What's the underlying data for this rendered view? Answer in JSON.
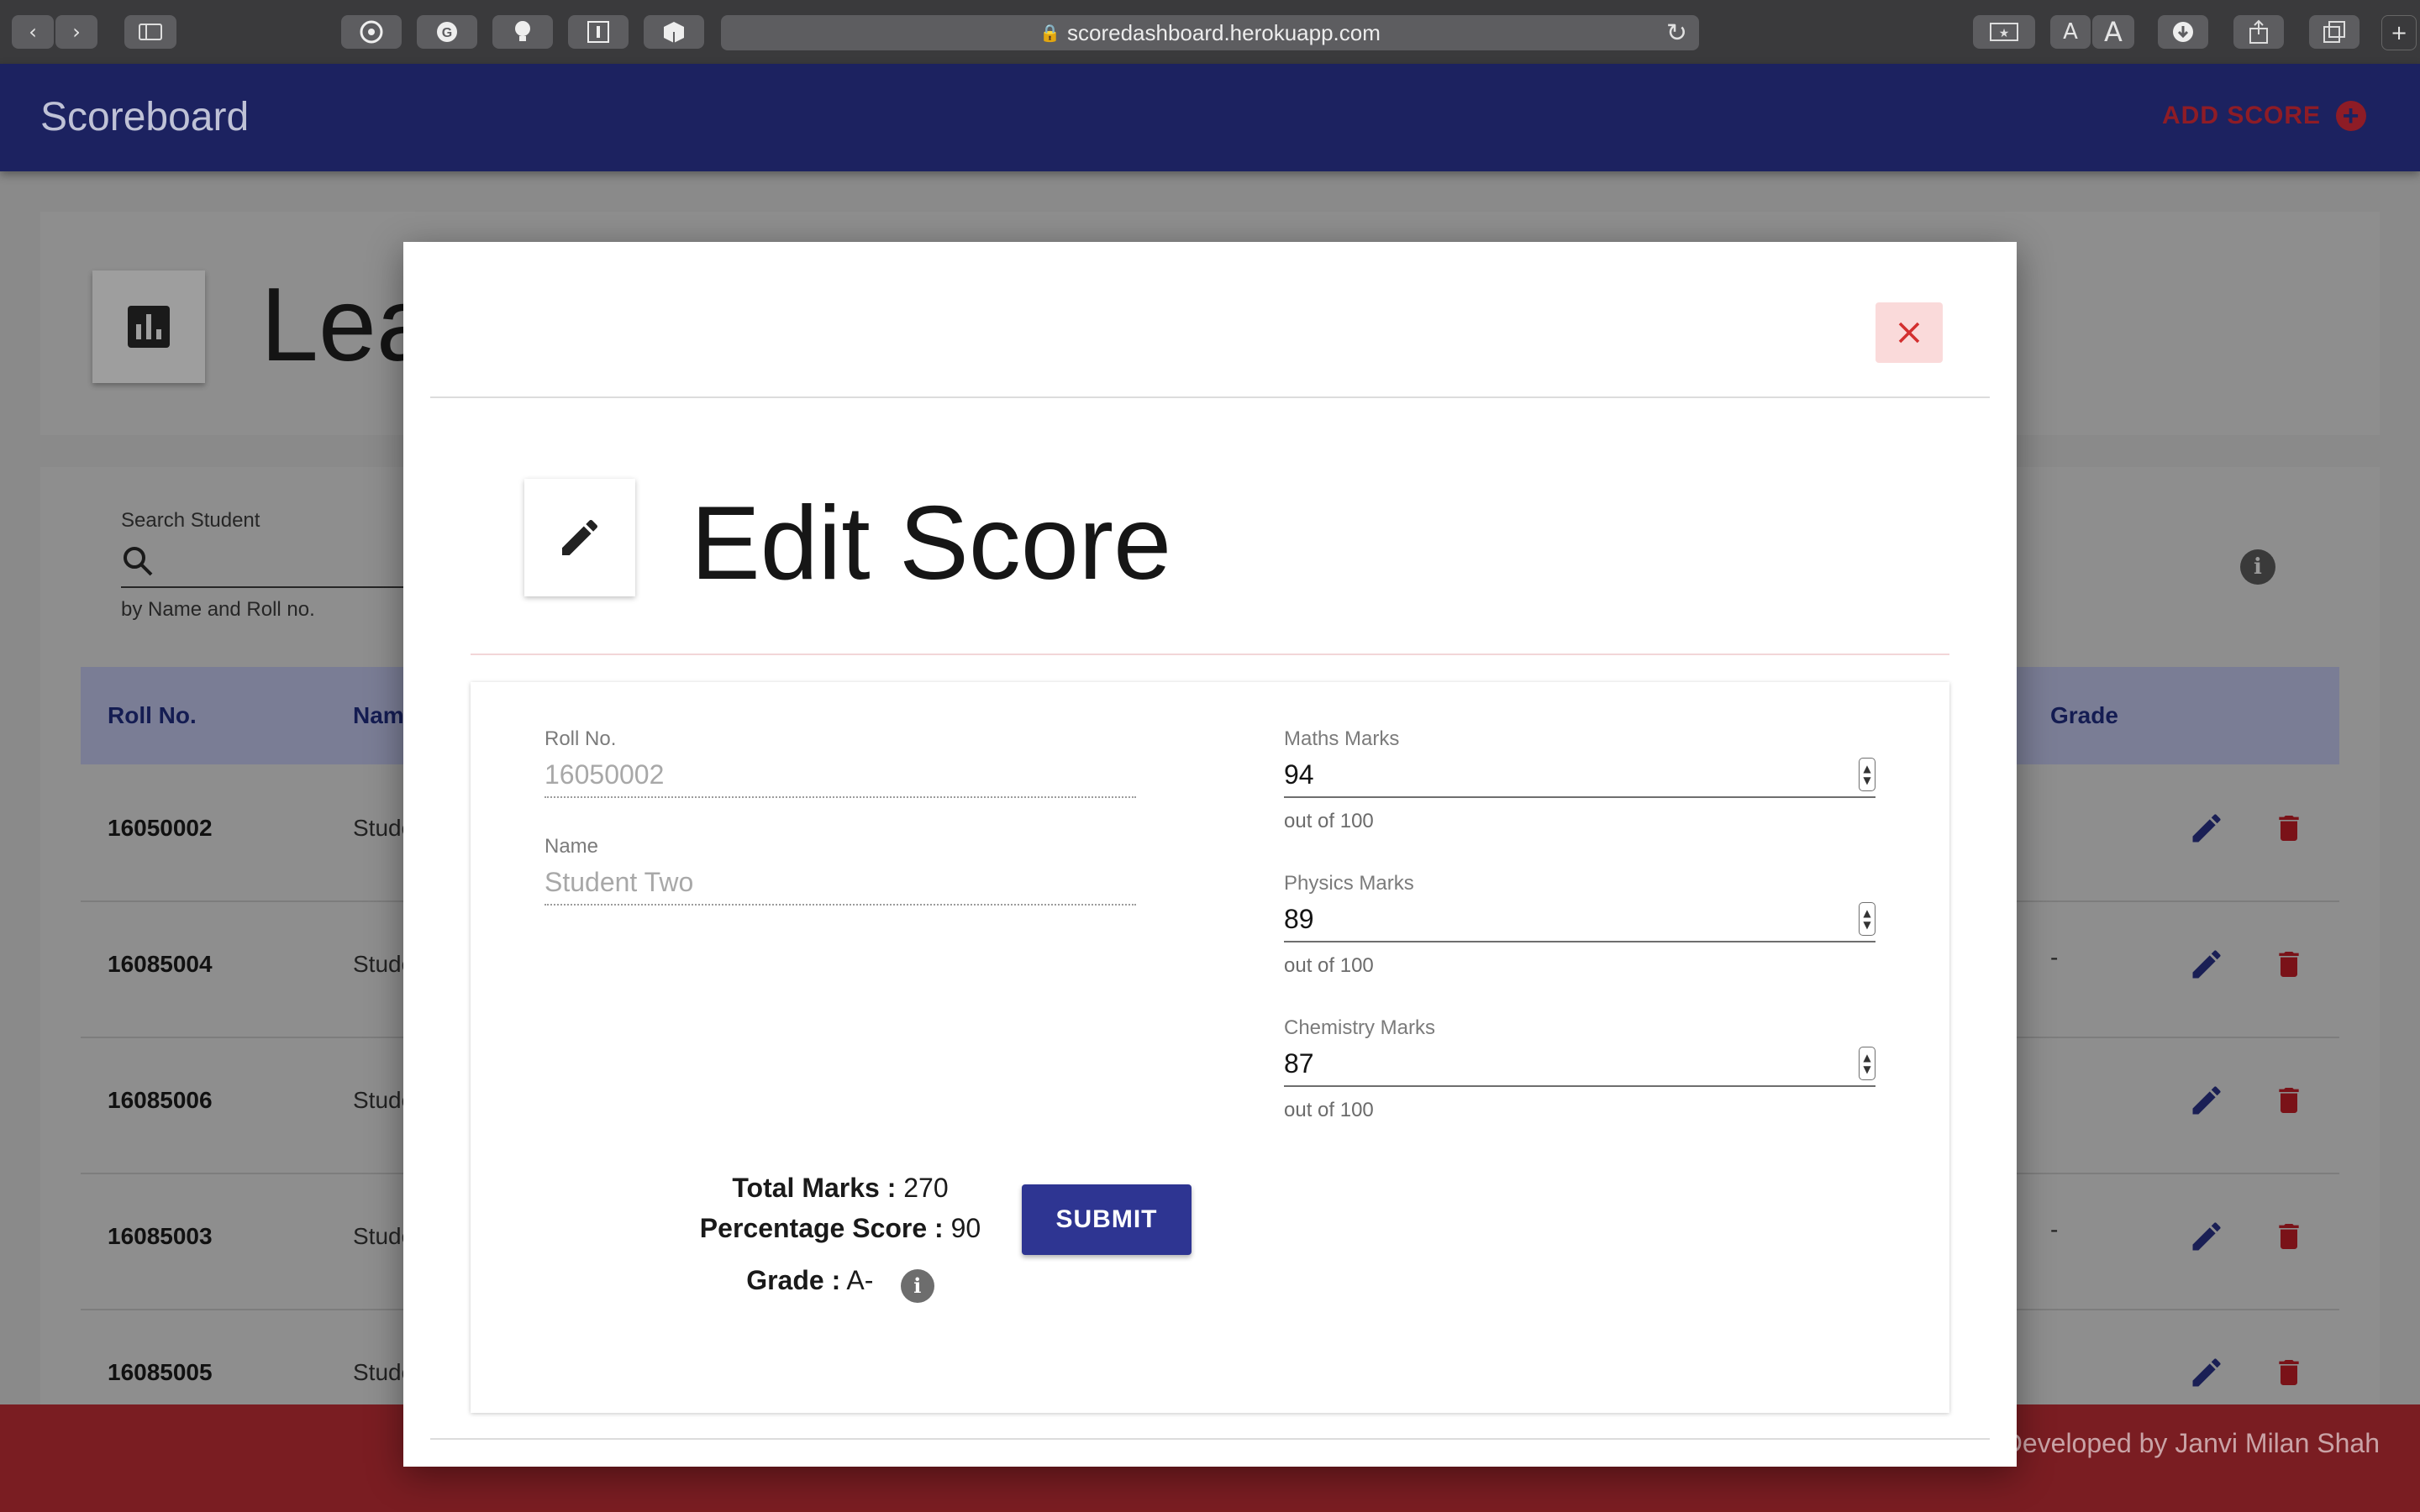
{
  "browser": {
    "url": "scoredashboard.herokuapp.com",
    "text_size_small": "A",
    "text_size_large": "A"
  },
  "app": {
    "title": "Scoreboard",
    "add_score_label": "ADD SCORE"
  },
  "background": {
    "page_title": "Leaderboard",
    "search": {
      "label": "Search Student",
      "hint": "by Name and Roll no."
    },
    "table": {
      "columns": [
        "Roll No.",
        "Name",
        "Grade"
      ],
      "rows": [
        {
          "roll": "16050002",
          "name": "Student Two",
          "grade": ""
        },
        {
          "roll": "16085004",
          "name": "Student Four",
          "grade": "-"
        },
        {
          "roll": "16085006",
          "name": "Student Six",
          "grade": ""
        },
        {
          "roll": "16085003",
          "name": "Student Three",
          "grade": "-"
        },
        {
          "roll": "16085005",
          "name": "Student Five",
          "grade": ""
        }
      ]
    },
    "footer_credit": "Developed by Janvi Milan Shah"
  },
  "modal": {
    "title": "Edit Score",
    "roll_label": "Roll No.",
    "roll_value": "16050002",
    "name_label": "Name",
    "name_value": "Student Two",
    "maths_label": "Maths Marks",
    "maths_value": "94",
    "physics_label": "Physics Marks",
    "physics_value": "89",
    "chemistry_label": "Chemistry Marks",
    "chemistry_value": "87",
    "out_of_hint": "out of 100",
    "total_label": "Total Marks :",
    "total_value": "270",
    "percentage_label": "Percentage Score :",
    "percentage_value": "90",
    "grade_label": "Grade :",
    "grade_value": "A-",
    "submit_label": "SUBMIT"
  },
  "colors": {
    "header": "#1c2260",
    "primary": "#2e3592",
    "danger": "#c62828",
    "close_bg": "#fadada"
  }
}
